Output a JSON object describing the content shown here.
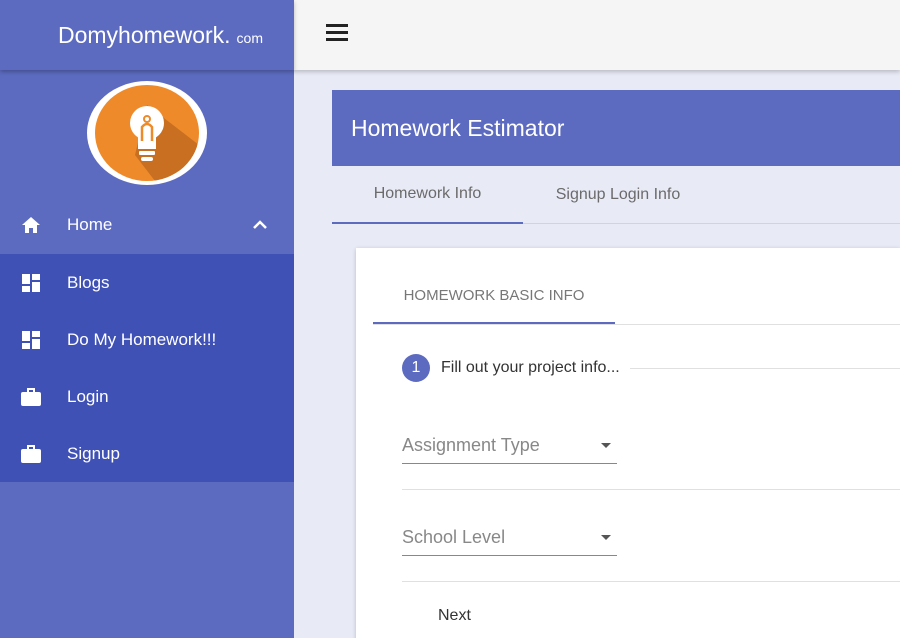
{
  "brand": {
    "main": "Domyhomework.",
    "sub": "com"
  },
  "sidebar": {
    "items": [
      {
        "label": "Home",
        "icon": "home-icon"
      },
      {
        "label": "Blogs",
        "icon": "dashboard-icon"
      },
      {
        "label": "Do My Homework!!!",
        "icon": "dashboard-icon"
      },
      {
        "label": "Login",
        "icon": "briefcase-icon"
      },
      {
        "label": "Signup",
        "icon": "briefcase-icon"
      }
    ]
  },
  "header": {
    "title": "Homework Estimator"
  },
  "tabs": [
    {
      "label": "Homework Info",
      "active": true
    },
    {
      "label": "Signup Login Info",
      "active": false
    }
  ],
  "card": {
    "tab_label": "HOMEWORK BASIC INFO",
    "step": {
      "number": "1",
      "label": "Fill out your project info..."
    },
    "fields": {
      "assignment_type": {
        "placeholder": "Assignment Type"
      },
      "school_level": {
        "placeholder": "School Level"
      }
    },
    "next_label": "Next"
  },
  "colors": {
    "primary": "#5c6bc0",
    "primary_dark": "#3f51b5",
    "accent_orange": "#ee8a2a",
    "background": "#e8eaf6"
  }
}
